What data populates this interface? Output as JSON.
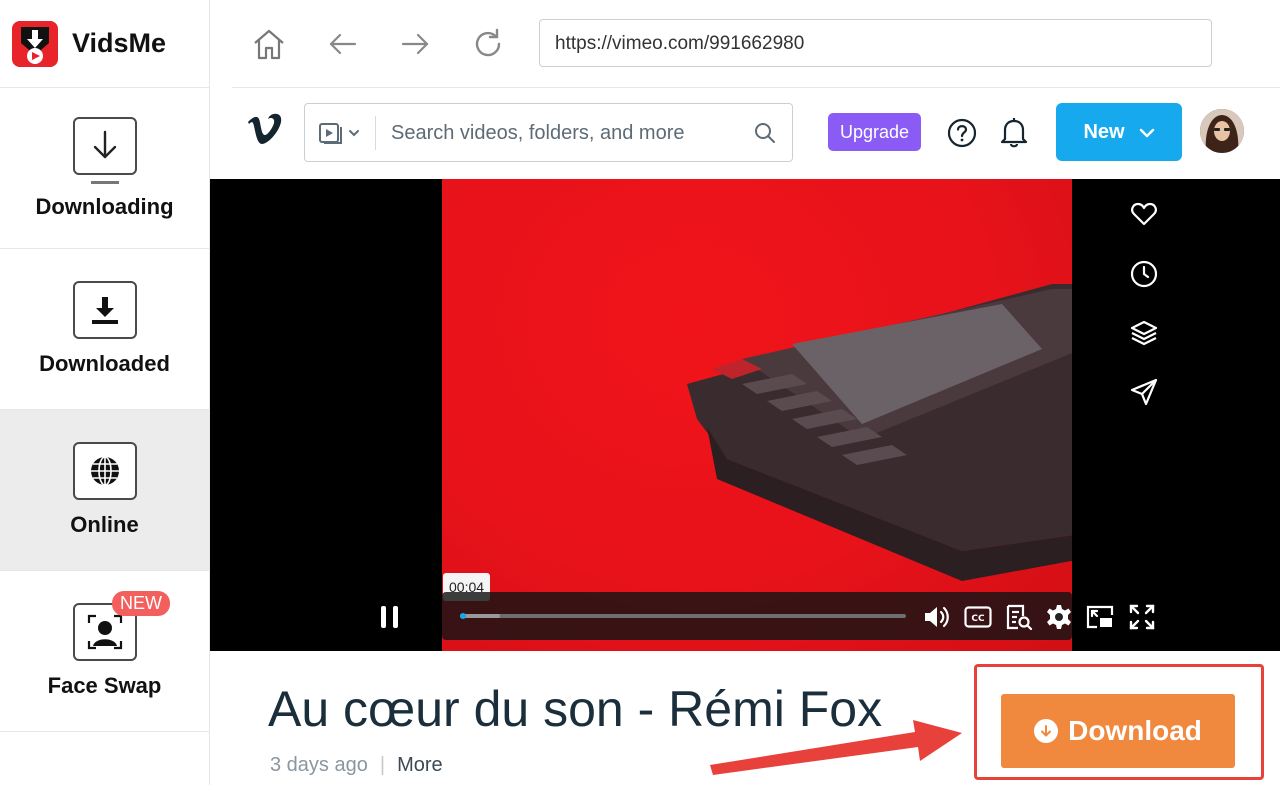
{
  "app": {
    "name": "VidsMe",
    "nav": [
      {
        "label": "Downloading",
        "icon": "download-arrow-icon"
      },
      {
        "label": "Downloaded",
        "icon": "download-tray-icon"
      },
      {
        "label": "Online",
        "icon": "globe-icon",
        "active": true
      },
      {
        "label": "Face Swap",
        "icon": "face-scan-icon",
        "badge": "NEW"
      }
    ]
  },
  "browser": {
    "url": "https://vimeo.com/991662980",
    "buttons": [
      "home-icon",
      "back-arrow-icon",
      "forward-arrow-icon",
      "reload-icon"
    ]
  },
  "vimeo": {
    "search_placeholder": "Search videos, folders, and more",
    "upgrade_label": "Upgrade",
    "new_label": "New",
    "icons": [
      "vimeo-logo-icon",
      "video-type-icon",
      "search-icon",
      "help-icon",
      "bell-icon"
    ]
  },
  "player": {
    "time": "00:04",
    "progress_fraction": 0.09,
    "side_icons": [
      "heart-icon",
      "clock-icon",
      "layers-icon",
      "send-icon"
    ],
    "control_icons": [
      "pause-icon",
      "volume-icon",
      "cc-icon",
      "transcript-icon",
      "settings-icon",
      "pip-icon",
      "fullscreen-icon"
    ]
  },
  "video": {
    "title": "Au cœur du son - Rémi Fox",
    "posted": "3 days ago",
    "more": "More"
  },
  "download": {
    "label": "Download",
    "accent": "#f0883e",
    "highlight": "#e8413c"
  }
}
